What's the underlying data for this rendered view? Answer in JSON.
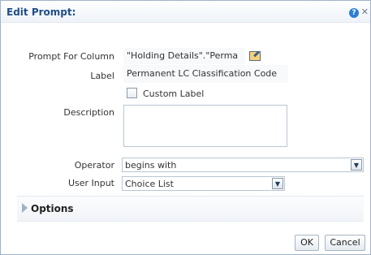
{
  "dialog": {
    "title": "Edit Prompt:",
    "help_icon": "?",
    "close_icon": "✕"
  },
  "form": {
    "prompt_for_column": {
      "label": "Prompt For Column",
      "value": "\"Holding Details\".\"Perma",
      "edit_icon": "edit-pencil-icon"
    },
    "label_field": {
      "label": "Label",
      "value": "Permanent LC Classification Code"
    },
    "custom_label": {
      "label": "Custom Label",
      "checked": false
    },
    "description": {
      "label": "Description",
      "value": ""
    },
    "operator": {
      "label": "Operator",
      "value": "begins with"
    },
    "user_input": {
      "label": "User Input",
      "value": "Choice List"
    }
  },
  "options_section": {
    "label": "Options",
    "expanded": false
  },
  "buttons": {
    "ok": "OK",
    "cancel": "Cancel"
  },
  "colors": {
    "title": "#1f4f86",
    "border": "#9fb3c8",
    "help_icon": "#2d7fd3"
  }
}
